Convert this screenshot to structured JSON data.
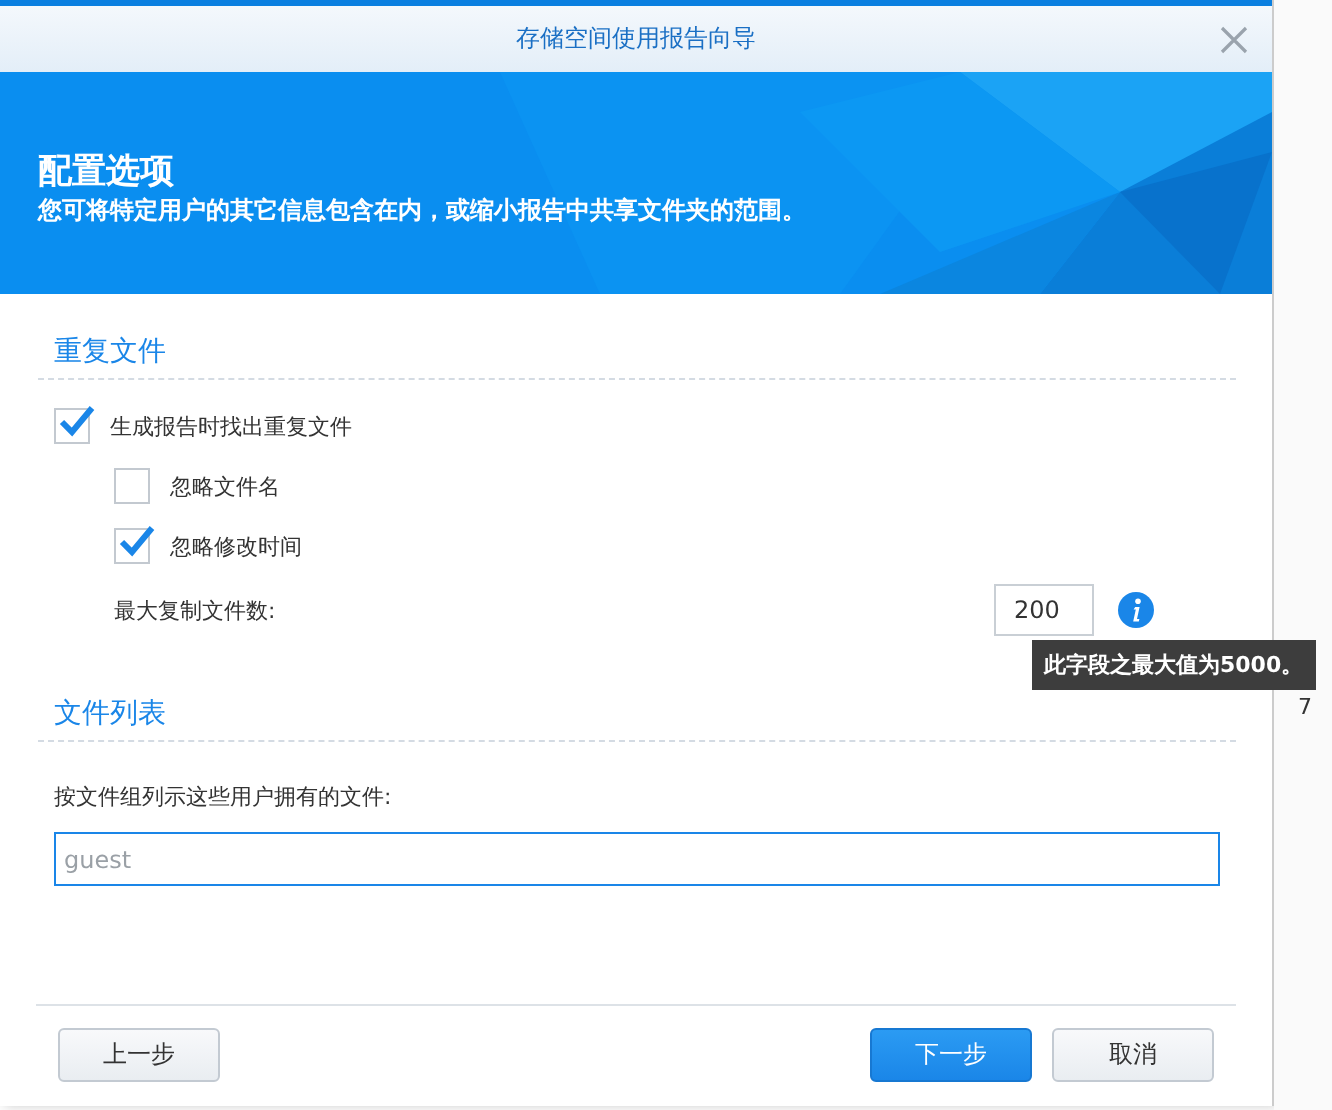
{
  "window": {
    "title": "存储空间使用报告向导"
  },
  "banner": {
    "title": "配置选项",
    "subtitle": "您可将特定用户的其它信息包含在内，或缩小报告中共享文件夹的范围。"
  },
  "duplicates": {
    "heading": "重复文件",
    "options": [
      {
        "label": "生成报告时找出重复文件",
        "checked": true,
        "children": [
          {
            "label": "忽略文件名",
            "checked": false
          },
          {
            "label": "忽略修改时间",
            "checked": true
          }
        ]
      }
    ],
    "max_copies": {
      "label": "最大复制文件数:",
      "value": "200"
    },
    "tooltip": "此字段之最大值为5000。"
  },
  "file_list": {
    "heading": "文件列表",
    "label": "按文件组列示这些用户拥有的文件:",
    "placeholder": "guest"
  },
  "buttons": [
    {
      "label": "上一步",
      "kind": "secondary"
    },
    {
      "label": "下一步",
      "kind": "primary"
    },
    {
      "label": "取消",
      "kind": "secondary"
    }
  ],
  "background_text": "7"
}
